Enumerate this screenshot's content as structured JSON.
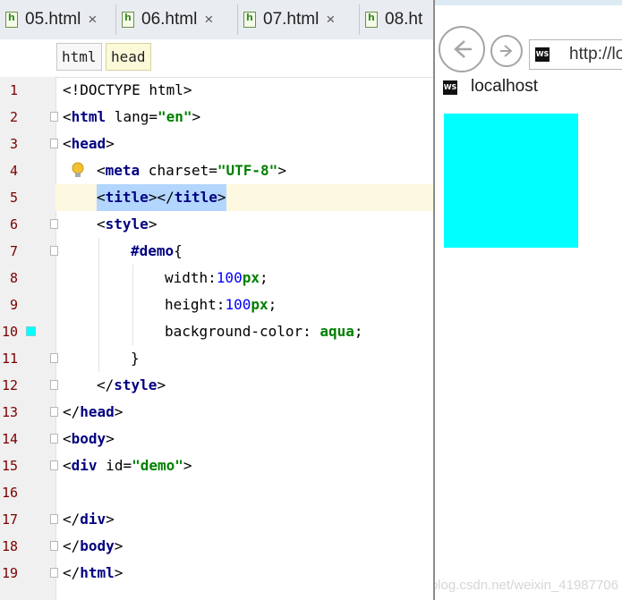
{
  "editor": {
    "tabs": [
      {
        "label": "05.html",
        "close": "×"
      },
      {
        "label": "06.html",
        "close": "×"
      },
      {
        "label": "07.html",
        "close": "×"
      },
      {
        "label": "08.ht",
        "close": ""
      }
    ],
    "breadcrumb": [
      "html",
      "head"
    ],
    "lines": [
      "1",
      "2",
      "3",
      "4",
      "5",
      "6",
      "7",
      "8",
      "9",
      "10",
      "11",
      "12",
      "13",
      "14",
      "15",
      "16",
      "17",
      "18",
      "19"
    ],
    "code": {
      "l1": "<!DOCTYPE html>",
      "l2_lt": "<",
      "l2_tag": "html",
      "l2_attr": " lang=",
      "l2_val": "\"en\"",
      "l2_gt": ">",
      "l3_lt": "<",
      "l3_tag": "head",
      "l3_gt": ">",
      "l4_lt": "<",
      "l4_tag": "meta",
      "l4_attr": " charset=",
      "l4_val": "\"UTF-8\"",
      "l4_gt": ">",
      "l5_a": "<",
      "l5_tag1": "title",
      "l5_b": "></",
      "l5_tag2": "title",
      "l5_c": ">",
      "l6_lt": "<",
      "l6_tag": "style",
      "l6_gt": ">",
      "l7_sel": "#demo",
      "l7_brace": "{",
      "l8_prop": "width:",
      "l8_num": "100",
      "l8_unit": "px",
      "l8_semi": ";",
      "l9_prop": "height:",
      "l9_num": "100",
      "l9_unit": "px",
      "l9_semi": ";",
      "l10_prop": "background-color: ",
      "l10_val": "aqua",
      "l10_semi": ";",
      "l11": "}",
      "l12_lt": "</",
      "l12_tag": "style",
      "l12_gt": ">",
      "l13_lt": "</",
      "l13_tag": "head",
      "l13_gt": ">",
      "l14_lt": "<",
      "l14_tag": "body",
      "l14_gt": ">",
      "l15_lt": "<",
      "l15_tag": "div",
      "l15_attr": " id=",
      "l15_val": "\"demo\"",
      "l15_gt": ">",
      "l17_lt": "</",
      "l17_tag": "div",
      "l17_gt": ">",
      "l18_lt": "</",
      "l18_tag": "body",
      "l18_gt": ">",
      "l19_lt": "</",
      "l19_tag": "html",
      "l19_gt": ">"
    },
    "current_line": 5,
    "gutter_color_marker": "#00ffff"
  },
  "browser": {
    "url": "http://lo",
    "tab_title": "localhost",
    "favicon_text": "WS",
    "demo_color": "#00ffff"
  },
  "watermark": "https://blog.csdn.net/weixin_41987706"
}
